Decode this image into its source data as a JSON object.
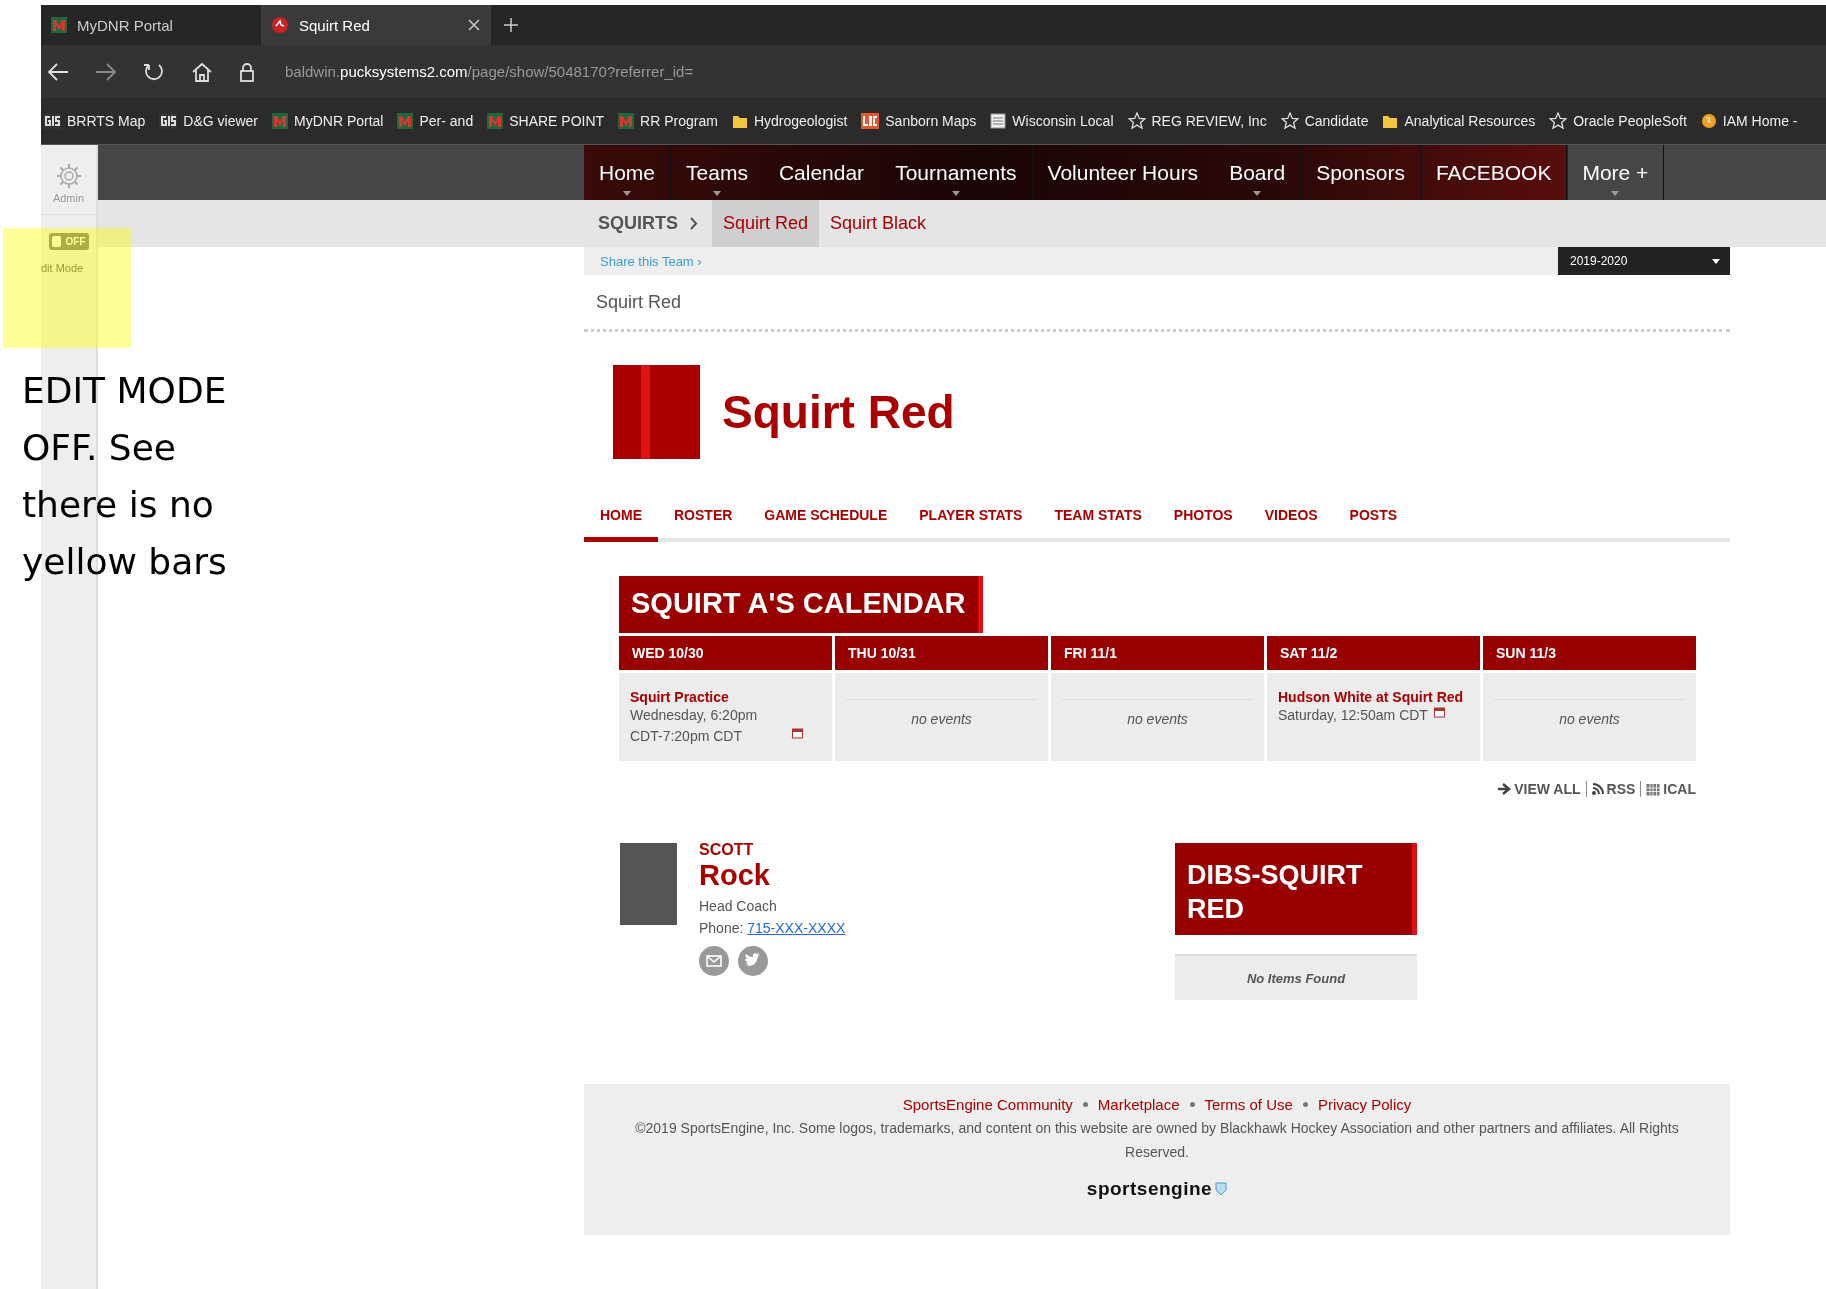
{
  "browser": {
    "tabs": [
      {
        "title": "MyDNR Portal",
        "selected": false
      },
      {
        "title": "Squirt Red",
        "selected": true
      }
    ],
    "address": {
      "subdomain": "baldwin.",
      "domain": "pucksystems2.com",
      "path": "/page/show/5048170?referrer_id="
    },
    "bookmarks": [
      {
        "label": "BRRTS Map",
        "kind": "gis"
      },
      {
        "label": "D&G viewer",
        "kind": "gis"
      },
      {
        "label": "MyDNR Portal",
        "kind": "m"
      },
      {
        "label": "Per- and",
        "kind": "m"
      },
      {
        "label": "SHARE POINT",
        "kind": "m"
      },
      {
        "label": "RR Program",
        "kind": "m"
      },
      {
        "label": "Hydrogeologist",
        "kind": "folder"
      },
      {
        "label": "Sanborn Maps",
        "kind": "loc"
      },
      {
        "label": "Wisconsin Local",
        "kind": "doc"
      },
      {
        "label": "REG REVIEW, Inc",
        "kind": "star"
      },
      {
        "label": "Candidate",
        "kind": "star"
      },
      {
        "label": "Analytical Resources",
        "kind": "folder"
      },
      {
        "label": "Oracle PeopleSoft",
        "kind": "star"
      },
      {
        "label": "IAM Home -",
        "kind": "globe"
      }
    ]
  },
  "admin_bar": {
    "admin_label": "Admin",
    "edit_mode": {
      "toggle_label": "OFF",
      "on": false,
      "label": "dit Mode"
    }
  },
  "annotation": {
    "text": "EDIT MODE OFF. See there is no yellow bars"
  },
  "site_nav": [
    {
      "label": "Home",
      "has_menu": true
    },
    {
      "label": "Teams",
      "has_menu": true
    },
    {
      "label": "Calendar",
      "has_menu": false
    },
    {
      "label": "Tournaments",
      "has_menu": true
    },
    {
      "label": "Volunteer Hours",
      "has_menu": false
    },
    {
      "label": "Board",
      "has_menu": true
    },
    {
      "label": "Sponsors",
      "has_menu": false
    },
    {
      "label": "FACEBOOK",
      "has_menu": false
    },
    {
      "label": "More +",
      "has_menu": true
    }
  ],
  "team_nav": {
    "group": "SQUIRTS",
    "teams": [
      {
        "label": "Squirt Red",
        "selected": true
      },
      {
        "label": "Squirt Black",
        "selected": false
      }
    ]
  },
  "share_link": "Share this Team ›",
  "season": "2019-2020",
  "breadcrumb": "Squirt Red",
  "team": {
    "name": "Squirt Red",
    "tabs": [
      {
        "label": "HOME",
        "selected": true
      },
      {
        "label": "ROSTER",
        "selected": false
      },
      {
        "label": "GAME SCHEDULE",
        "selected": false
      },
      {
        "label": "PLAYER STATS",
        "selected": false
      },
      {
        "label": "TEAM STATS",
        "selected": false
      },
      {
        "label": "PHOTOS",
        "selected": false
      },
      {
        "label": "VIDEOS",
        "selected": false
      },
      {
        "label": "POSTS",
        "selected": false
      }
    ]
  },
  "calendar": {
    "title": "SQUIRT A'S CALENDAR",
    "days": [
      {
        "day": "WED 10/30",
        "events": [
          {
            "title": "Squirt Practice",
            "time": "Wednesday, 6:20pm CDT-7:20pm CDT"
          }
        ]
      },
      {
        "day": "THU 10/31",
        "empty_text": "no events"
      },
      {
        "day": "FRI 11/1",
        "empty_text": "no events"
      },
      {
        "day": "SAT 11/2",
        "events": [
          {
            "title": "Hudson White at Squirt Red",
            "time": "Saturday, 12:50am CDT"
          }
        ]
      },
      {
        "day": "SUN 11/3",
        "empty_text": "no events"
      }
    ],
    "links": [
      {
        "label": "VIEW ALL",
        "kind": "arrow"
      },
      {
        "label": "RSS",
        "kind": "rss"
      },
      {
        "label": "ICAL",
        "kind": "calendar"
      }
    ]
  },
  "coach": {
    "first_name": "SCOTT",
    "last_name": "Rock",
    "role": "Head Coach",
    "phone_label": "Phone:",
    "phone": "715-XXX-XXXX",
    "contacts": [
      {
        "kind": "email"
      },
      {
        "kind": "twitter"
      }
    ]
  },
  "dibs": {
    "title": "DIBS-SQUIRT RED",
    "empty_text": "No Items Found"
  },
  "footer": {
    "links": [
      "SportsEngine Community",
      "Marketplace",
      "Terms of Use",
      "Privacy Policy"
    ],
    "copyright": "©2019 SportsEngine, Inc. Some logos, trademarks, and content on this website are owned by Blackhawk Hockey Association and other partners and affiliates. All Rights Reserved.",
    "logo": "sportsengine"
  }
}
